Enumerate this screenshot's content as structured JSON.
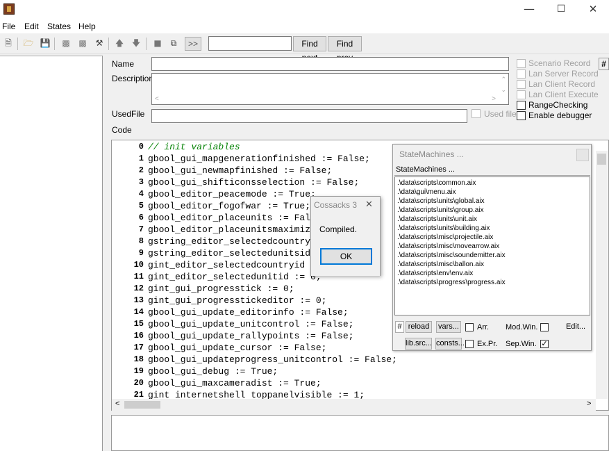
{
  "menu": {
    "file": "File",
    "edit": "Edit",
    "states": "States",
    "help": "Help"
  },
  "window_controls": {
    "minimize": "—",
    "maximize": "☐",
    "close": "✕"
  },
  "toolbar": {
    "find_next": "Find next",
    "find_prev": "Find prev",
    "chevron": ">>",
    "search_value": ""
  },
  "form": {
    "name_label": "Name",
    "description_label": "Description",
    "usedfile_label": "UsedFile",
    "code_label": "Code",
    "usedfile_checkbox": "Used file",
    "hash_button": "#",
    "checkboxes": [
      {
        "label": "Scenario Record",
        "enabled": false,
        "checked": false
      },
      {
        "label": "Lan Server Record",
        "enabled": false,
        "checked": false
      },
      {
        "label": "Lan Client Record",
        "enabled": false,
        "checked": false
      },
      {
        "label": "Lan Client Execute",
        "enabled": false,
        "checked": false
      },
      {
        "label": "RangeChecking",
        "enabled": true,
        "checked": false
      },
      {
        "label": "Enable debugger",
        "enabled": true,
        "checked": false
      }
    ]
  },
  "code": [
    {
      "n": "0",
      "text": "// init variables",
      "comment": true
    },
    {
      "n": "1",
      "text": "gbool_gui_mapgenerationfinished := False;"
    },
    {
      "n": "2",
      "text": "gbool_gui_newmapfinished := False;"
    },
    {
      "n": "3",
      "text": "gbool_gui_shifticonsselection := False;"
    },
    {
      "n": "4",
      "text": "gbool_editor_peacemode := True;"
    },
    {
      "n": "5",
      "text": "gbool_editor_fogofwar := True;"
    },
    {
      "n": "6",
      "text": "gbool_editor_placeunits := False;"
    },
    {
      "n": "7",
      "text": "gbool_editor_placeunitsmaximized := False;"
    },
    {
      "n": "8",
      "text": "gstring_editor_selectedcountry := '';"
    },
    {
      "n": "9",
      "text": "gstring_editor_selectedunitsid := '';"
    },
    {
      "n": "10",
      "text": "gint_editor_selectedcountryid := 0;"
    },
    {
      "n": "11",
      "text": "gint_editor_selectedunitid := 0;"
    },
    {
      "n": "12",
      "text": "gint_gui_progresstick := 0;"
    },
    {
      "n": "13",
      "text": "gint_gui_progresstickeditor := 0;"
    },
    {
      "n": "14",
      "text": "gbool_gui_update_editorinfo := False;"
    },
    {
      "n": "15",
      "text": "gbool_gui_update_unitcontrol := False;"
    },
    {
      "n": "16",
      "text": "gbool_gui_update_rallypoints := False;"
    },
    {
      "n": "17",
      "text": "gbool_gui_update_cursor := False;"
    },
    {
      "n": "18",
      "text": "gbool_gui_updateprogress_unitcontrol := False;"
    },
    {
      "n": "19",
      "text": "gbool_gui_debug := True;"
    },
    {
      "n": "20",
      "text": "gbool_gui_maxcameradist := True;"
    },
    {
      "n": "21",
      "text": "gint internetshell toppanelvisible := 1;"
    }
  ],
  "state_machines": {
    "title": "StateMachines ...",
    "header": "StateMachines ...",
    "items": [
      ".\\data\\scripts\\common.aix",
      ".\\data\\gui\\menu.aix",
      ".\\data\\scripts\\units\\global.aix",
      ".\\data\\scripts\\units\\group.aix",
      ".\\data\\scripts\\units\\unit.aix",
      ".\\data\\scripts\\units\\building.aix",
      ".\\data\\scripts\\misc\\projectile.aix",
      ".\\data\\scripts\\misc\\movearrow.aix",
      ".\\data\\scripts\\misc\\soundemitter.aix",
      ".\\data\\scripts\\misc\\ballon.aix",
      ".\\data\\scripts\\env\\env.aix",
      ".\\data\\scripts\\progress\\progress.aix"
    ],
    "hash": "#",
    "reload": "reload",
    "vars": "vars...",
    "arr": "Arr.",
    "modwin": "Mod.Win.",
    "edit": "Edit...",
    "libsrc": "lib.src...",
    "consts": "consts...",
    "expr": "Ex.Pr.",
    "sepwin": "Sep.Win.",
    "sepwin_checked": true
  },
  "dialog": {
    "title": "Cossacks 3",
    "message": "Compiled.",
    "ok": "OK",
    "close": "✕"
  }
}
